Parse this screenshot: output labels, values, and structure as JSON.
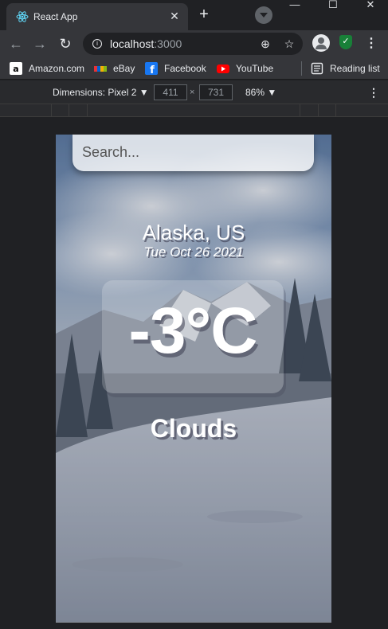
{
  "browser": {
    "tab": {
      "title": "React App",
      "close": "✕"
    },
    "new_tab": "+",
    "window_controls": {
      "minimize": "—",
      "maximize": "☐",
      "close": "✕"
    },
    "address": {
      "host": "localhost",
      "port": ":3000"
    },
    "bookmarks": [
      {
        "label": "Amazon.com",
        "icon": "amazon-icon"
      },
      {
        "label": "eBay",
        "icon": "ebay-icon"
      },
      {
        "label": "Facebook",
        "icon": "facebook-icon"
      },
      {
        "label": "YouTube",
        "icon": "youtube-icon"
      }
    ],
    "reading_list": "Reading list"
  },
  "devtools": {
    "device": "Dimensions: Pixel 2 ▼",
    "width": "411",
    "height": "731",
    "times": "×",
    "zoom": "86% ▼"
  },
  "app": {
    "search_placeholder": "Search...",
    "location": "Alaska, US",
    "date": "Tue Oct 26 2021",
    "temperature": "-3°C",
    "condition": "Clouds"
  }
}
